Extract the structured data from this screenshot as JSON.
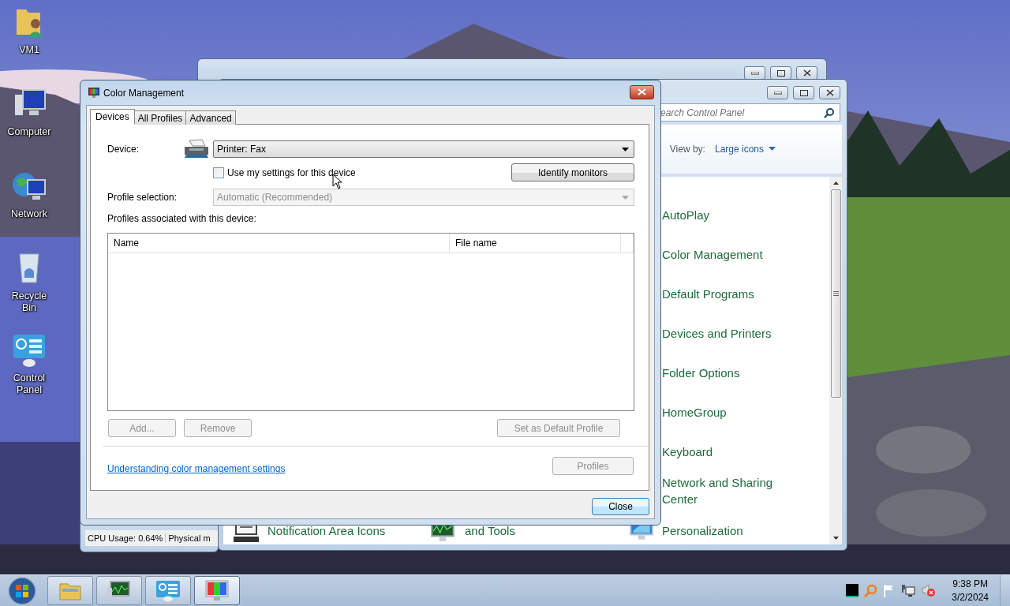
{
  "desktop_icons": [
    {
      "label": "VM1",
      "kind": "user-folder"
    },
    {
      "label": "Computer",
      "kind": "computer"
    },
    {
      "label": "Network",
      "kind": "network"
    },
    {
      "label": "Recycle Bin",
      "kind": "recycle-bin"
    },
    {
      "label": "Control Panel",
      "kind": "control-panel"
    }
  ],
  "background_window": {
    "status_bar": [
      "CPU Usage: 0.64%",
      "Physical m"
    ]
  },
  "control_panel": {
    "search": {
      "placeholder": "earch Control Panel"
    },
    "view_by": {
      "label": "View by:",
      "value": "Large icons"
    },
    "items": [
      {
        "label": "AutoPlay"
      },
      {
        "label": "Color Management"
      },
      {
        "label": "Default Programs"
      },
      {
        "label": "Devices and Printers"
      },
      {
        "label": "Folder Options"
      },
      {
        "label": "HomeGroup"
      },
      {
        "label": "Keyboard"
      },
      {
        "label": "Network and Sharing Center"
      },
      {
        "label": "Personalization"
      }
    ],
    "bottom_row_items": [
      {
        "label": "Notification Area Icons",
        "kind": "notification"
      },
      {
        "label": "and Tools",
        "kind": "performance"
      }
    ]
  },
  "dialog": {
    "title": "Color Management",
    "tabs": [
      {
        "label": "Devices",
        "selected": true
      },
      {
        "label": "All Profiles",
        "selected": false
      },
      {
        "label": "Advanced",
        "selected": false
      }
    ],
    "device": {
      "label": "Device:",
      "value": "Printer: Fax"
    },
    "use_my_settings": {
      "label": "Use my settings for this device",
      "checked": false
    },
    "identify_button": "Identify monitors",
    "profile_selection": {
      "label": "Profile selection:",
      "value": "Automatic (Recommended)",
      "disabled": true
    },
    "profiles_label": "Profiles associated with this device:",
    "columns": [
      "Name",
      "File name"
    ],
    "list_buttons": [
      {
        "label": "Add...",
        "disabled": true
      },
      {
        "label": "Remove",
        "disabled": true
      },
      {
        "label": "Set as Default Profile",
        "disabled": true
      }
    ],
    "link": "Understanding color management settings",
    "profiles_button": {
      "label": "Profiles",
      "disabled": true
    },
    "close_button": "Close"
  },
  "taskbar": {
    "buttons": [
      {
        "kind": "explorer",
        "selected": false
      },
      {
        "kind": "task-manager",
        "selected": false
      },
      {
        "kind": "control-panel",
        "selected": false
      },
      {
        "kind": "color-management",
        "selected": true
      }
    ],
    "clock": {
      "time": "9:38 PM",
      "date": "3/2/2024"
    }
  }
}
